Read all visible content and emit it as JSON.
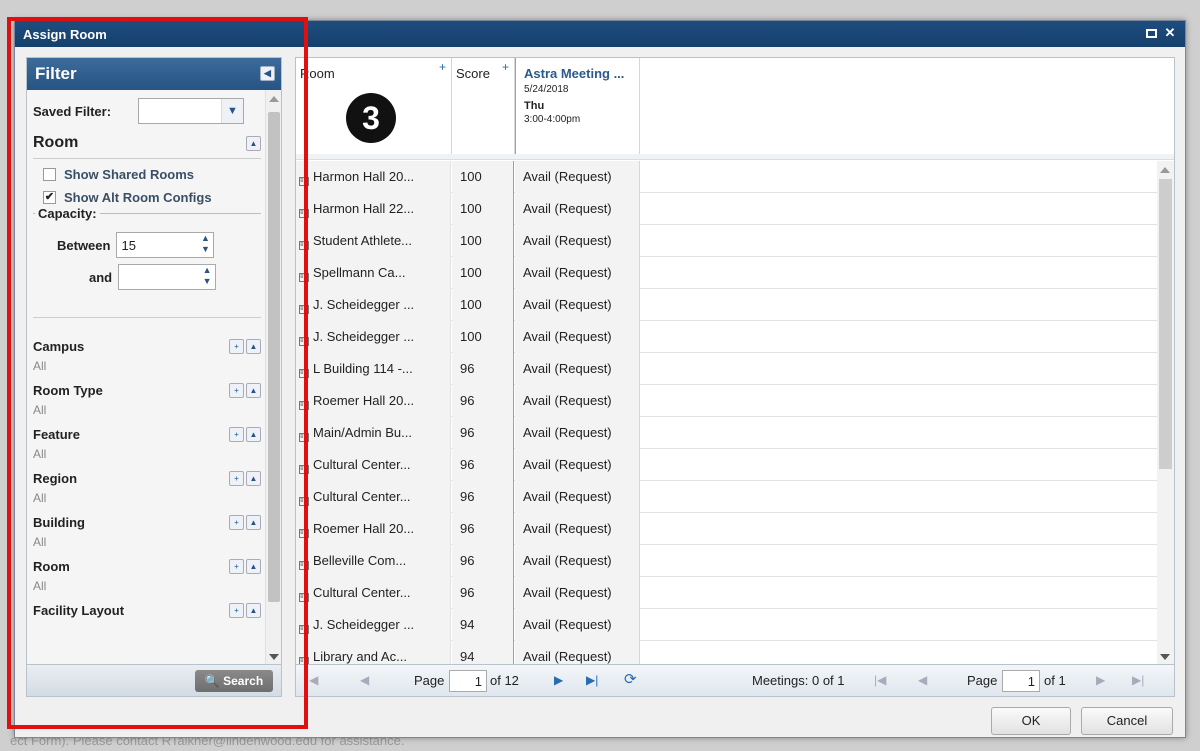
{
  "background_footer": "ect Form). Please contact RTalkner@lindenwood.edu for assistance.",
  "dialog": {
    "title": "Assign Room",
    "ok_label": "OK",
    "cancel_label": "Cancel"
  },
  "filter": {
    "title": "Filter",
    "saved_filter_label": "Saved Filter:",
    "saved_filter_value": "",
    "room_heading": "Room",
    "show_shared_label": "Show Shared Rooms",
    "show_shared_checked": false,
    "show_alt_label": "Show Alt Room Configs",
    "show_alt_checked": true,
    "capacity_label": "Capacity:",
    "between_label": "Between",
    "between_value": "15",
    "and_label": "and",
    "and_value": "",
    "sections": [
      {
        "label": "Campus",
        "value": "All"
      },
      {
        "label": "Room Type",
        "value": "All"
      },
      {
        "label": "Feature",
        "value": "All"
      },
      {
        "label": "Region",
        "value": "All"
      },
      {
        "label": "Building",
        "value": "All"
      },
      {
        "label": "Room",
        "value": "All"
      },
      {
        "label": "Facility Layout",
        "value": ""
      }
    ],
    "search_label": "Search"
  },
  "grid": {
    "col_room": "Room",
    "col_score": "Score",
    "badge": "3",
    "meeting": {
      "title": "Astra Meeting ...",
      "date": "5/24/2018",
      "day": "Thu",
      "time": "3:00-4:00pm"
    },
    "rows": [
      {
        "room": "Harmon Hall 20...",
        "score": "100",
        "avail": "Avail (Request)"
      },
      {
        "room": "Harmon Hall 22...",
        "score": "100",
        "avail": "Avail (Request)"
      },
      {
        "room": "Student Athlete...",
        "score": "100",
        "avail": "Avail (Request)"
      },
      {
        "room": "Spellmann Ca...",
        "score": "100",
        "avail": "Avail (Request)"
      },
      {
        "room": "J. Scheidegger ...",
        "score": "100",
        "avail": "Avail (Request)"
      },
      {
        "room": "J. Scheidegger ...",
        "score": "100",
        "avail": "Avail (Request)"
      },
      {
        "room": "L Building 114 -...",
        "score": "96",
        "avail": "Avail (Request)"
      },
      {
        "room": "Roemer Hall 20...",
        "score": "96",
        "avail": "Avail (Request)"
      },
      {
        "room": "Main/Admin Bu...",
        "score": "96",
        "avail": "Avail (Request)"
      },
      {
        "room": "Cultural Center...",
        "score": "96",
        "avail": "Avail (Request)"
      },
      {
        "room": "Cultural Center...",
        "score": "96",
        "avail": "Avail (Request)"
      },
      {
        "room": "Roemer Hall 20...",
        "score": "96",
        "avail": "Avail (Request)"
      },
      {
        "room": "Belleville Com...",
        "score": "96",
        "avail": "Avail (Request)"
      },
      {
        "room": "Cultural Center...",
        "score": "96",
        "avail": "Avail (Request)"
      },
      {
        "room": "J. Scheidegger ...",
        "score": "94",
        "avail": "Avail (Request)"
      },
      {
        "room": "Library and Ac...",
        "score": "94",
        "avail": "Avail (Request)"
      }
    ],
    "pager_left": {
      "page_label": "Page",
      "page_value": "1",
      "of_label": "of 12"
    },
    "pager_right": {
      "meetings_label": "Meetings: 0 of 1",
      "page_label": "Page",
      "page_value": "1",
      "of_label": "of 1"
    }
  }
}
